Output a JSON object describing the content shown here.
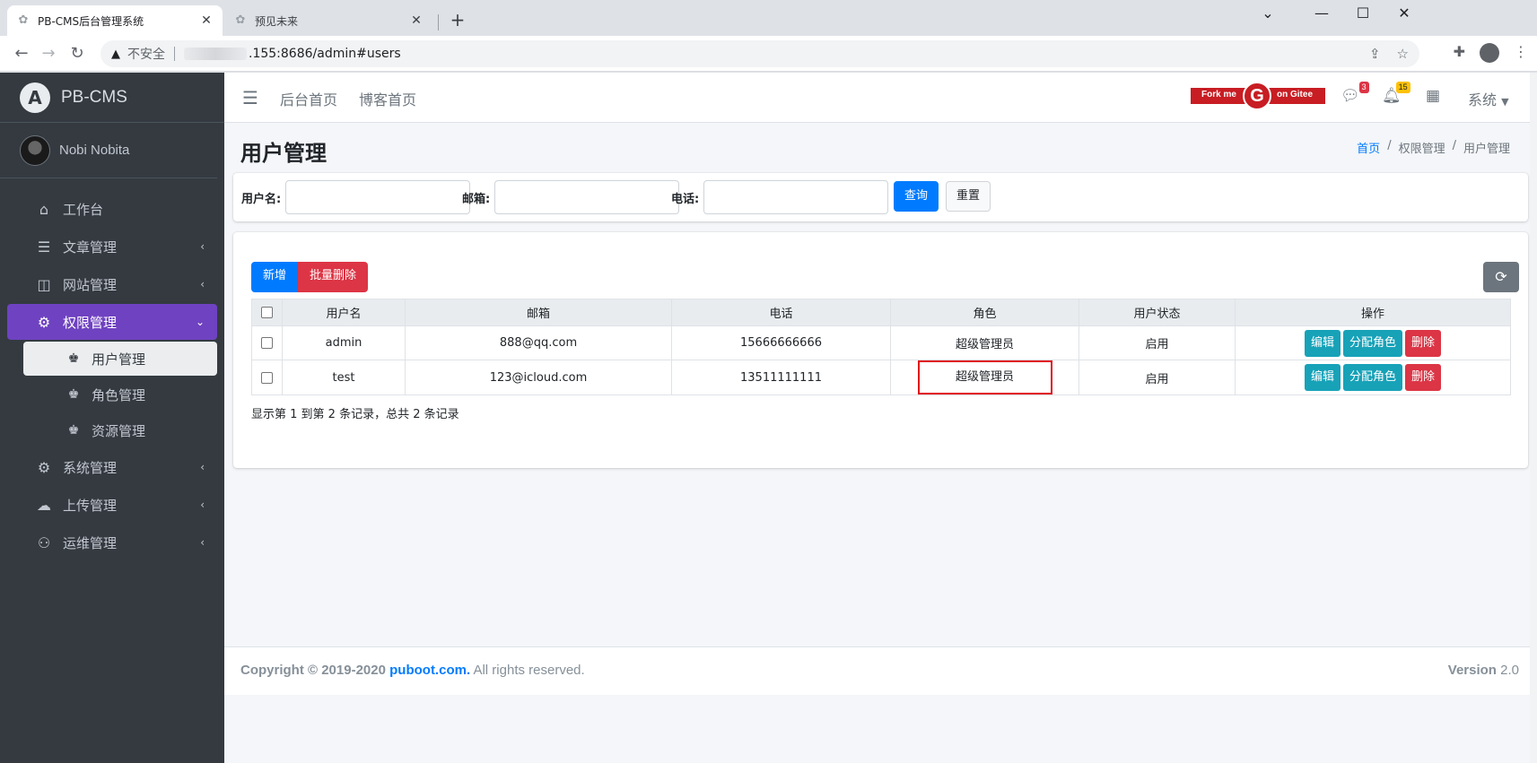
{
  "browser": {
    "tabs": [
      {
        "title": "PB-CMS后台管理系统",
        "active": true
      },
      {
        "title": "预见未来",
        "active": false
      }
    ],
    "new_tab": "+",
    "address": {
      "security_label": "不安全",
      "url": ".155:8686/admin#users"
    },
    "window_controls": {
      "minimize": "⌄",
      "restore": "—",
      "maximize": "☐",
      "close": "✕"
    }
  },
  "sidebar": {
    "brand": "PB-CMS",
    "brand_logo": "A",
    "user_name": "Nobi Nobita",
    "items": [
      {
        "label": "工作台",
        "icon": "home-icon",
        "has_chevron": false
      },
      {
        "label": "文章管理",
        "icon": "list-icon",
        "has_chevron": true
      },
      {
        "label": "网站管理",
        "icon": "columns-icon",
        "has_chevron": true
      },
      {
        "label": "权限管理",
        "icon": "users-cog-icon",
        "has_chevron": true,
        "open": true
      }
    ],
    "subitems": [
      {
        "label": "用户管理",
        "active": true
      },
      {
        "label": "角色管理",
        "active": false
      },
      {
        "label": "资源管理",
        "active": false
      }
    ],
    "items_after": [
      {
        "label": "系统管理",
        "icon": "cog-icon"
      },
      {
        "label": "上传管理",
        "icon": "cloud-upload-icon"
      },
      {
        "label": "运维管理",
        "icon": "people-carry-icon"
      }
    ]
  },
  "topnav": {
    "links": [
      "后台首页",
      "博客首页"
    ],
    "gitee": {
      "left": "Fork me",
      "letter": "G",
      "right": "on Gitee"
    },
    "messages_badge": "3",
    "notifications_badge": "15",
    "system_menu": "系统"
  },
  "page": {
    "title": "用户管理",
    "breadcrumb": [
      "首页",
      "权限管理",
      "用户管理"
    ],
    "breadcrumb_sep": "/"
  },
  "search": {
    "fields": [
      {
        "label": "用户名:",
        "value": ""
      },
      {
        "label": "邮箱:",
        "value": ""
      },
      {
        "label": "电话:",
        "value": ""
      }
    ],
    "query_button": "查询",
    "reset_button": "重置"
  },
  "toolbar": {
    "add_button": "新增",
    "batch_delete_button": "批量删除",
    "refresh_icon": "sync-icon"
  },
  "table": {
    "columns": [
      "用户名",
      "邮箱",
      "电话",
      "角色",
      "用户状态",
      "操作"
    ],
    "rows": [
      {
        "username": "admin",
        "email": "888@qq.com",
        "phone": "15666666666",
        "role": "超级管理员",
        "status": "启用"
      },
      {
        "username": "test",
        "email": "123@icloud.com",
        "phone": "13511111111",
        "role": "超级管理员",
        "status": "启用"
      }
    ],
    "actions": {
      "edit": "编辑",
      "assign": "分配角色",
      "delete": "删除"
    },
    "summary": "显示第 1 到第 2 条记录，总共 2 条记录"
  },
  "footer": {
    "copyright_prefix": "Copyright © 2019-2020",
    "brand": "puboot.com.",
    "rights": "All rights reserved.",
    "version_label": "Version",
    "version": "2.0"
  },
  "colors": {
    "sidebar_bg": "#343a40",
    "active_menu": "#6f42c1",
    "primary": "#007bff",
    "danger": "#dc3545",
    "info": "#17a2b8",
    "highlight_box": "#e0121c"
  }
}
